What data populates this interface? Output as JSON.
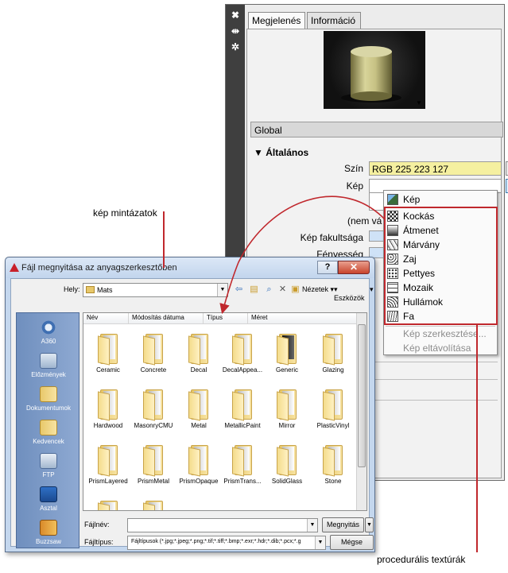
{
  "palette": {
    "tabs": [
      "Megjelenés",
      "Információ"
    ],
    "strip_icons": [
      "close-icon",
      "autohide-icon",
      "settings-icon"
    ],
    "global_label": "Global",
    "section_title": "Általános",
    "props": {
      "color_label": "Szín",
      "color_value": "RGB 225 223 127",
      "image_label": "Kép",
      "nem_label": "(nem vá",
      "fade_label": "Kép fakultsága",
      "gloss_label": "Fényesség"
    },
    "menu": {
      "items": [
        "Kép",
        "Kockás",
        "Átmenet",
        "Márvány",
        "Zaj",
        "Pettyes",
        "Mozaik",
        "Hullámok",
        "Fa"
      ],
      "disabled_items": [
        "Kép szerkesztése...",
        "Kép eltávolítása"
      ]
    }
  },
  "annotations": {
    "top": "kép mintázatok",
    "bottom": "procedurális textúrák"
  },
  "dialog": {
    "title": "Fájl megnyitása az anyagszerkesztőben",
    "help": "?",
    "close": "✕",
    "location_label": "Hely:",
    "location_value": "Mats",
    "views_label": "Nézetek",
    "tools_label": "Eszközök",
    "places": [
      "A360",
      "Előzmények",
      "Dokumentumok",
      "Kedvencek",
      "FTP",
      "Asztal",
      "Buzzsaw"
    ],
    "columns": [
      "Név",
      "Módosítás dátuma",
      "Típus",
      "Méret"
    ],
    "folders": [
      "Ceramic",
      "Concrete",
      "Decal",
      "DecalAppea...",
      "Generic",
      "Glazing",
      "Hardwood",
      "MasonryCMU",
      "Metal",
      "MetallicPaint",
      "Mirror",
      "PlasticVinyl",
      "PrismLayered",
      "PrismMetal",
      "PrismOpaque",
      "PrismTrans...",
      "SolidGlass",
      "Stone"
    ],
    "filename_label": "Fájlnév:",
    "filename_value": "",
    "filetype_label": "Fájltípus:",
    "filetype_value": "Fájltípusok (*.jpg;*.jpeg;*.png;*.tif;*.tiff;*.bmp;*.exr;*.hdr;*.dib;*.pcx;*.g",
    "open_button": "Megnyitás",
    "cancel_button": "Mégse"
  }
}
